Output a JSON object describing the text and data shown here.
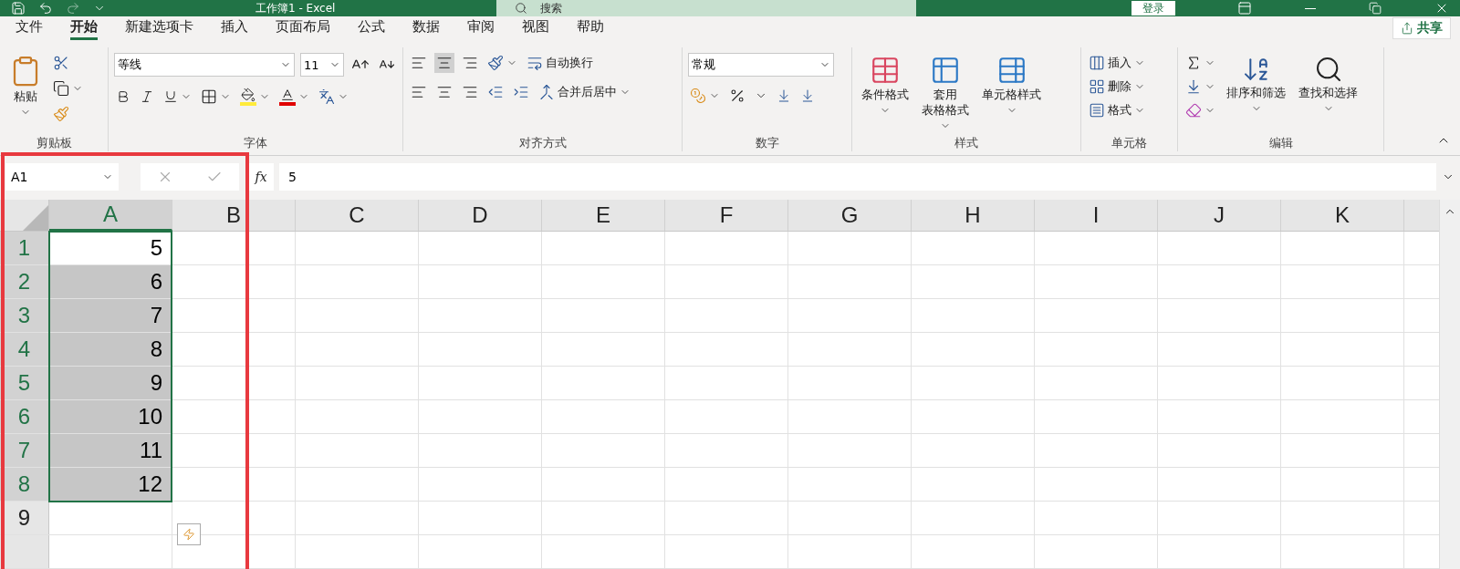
{
  "title_bar": {
    "title": "工作簿1 - Excel",
    "search_placeholder": "搜索",
    "login": "登录"
  },
  "tabs": [
    {
      "label": "文件",
      "selected": false
    },
    {
      "label": "开始",
      "selected": true
    },
    {
      "label": "新建选项卡",
      "selected": false
    },
    {
      "label": "插入",
      "selected": false
    },
    {
      "label": "页面布局",
      "selected": false
    },
    {
      "label": "公式",
      "selected": false
    },
    {
      "label": "数据",
      "selected": false
    },
    {
      "label": "审阅",
      "selected": false
    },
    {
      "label": "视图",
      "selected": false
    },
    {
      "label": "帮助",
      "selected": false
    }
  ],
  "share": "共享",
  "ribbon": {
    "clipboard": {
      "label": "剪贴板",
      "paste": "粘贴"
    },
    "font": {
      "label": "字体",
      "font_name": "等线",
      "font_size": "11"
    },
    "alignment": {
      "label": "对齐方式",
      "wrap": "自动换行",
      "merge": "合并后居中"
    },
    "number": {
      "label": "数字",
      "format": "常规"
    },
    "styles": {
      "label": "样式",
      "items": [
        "条件格式",
        "套用表格格式",
        "单元格样式"
      ]
    },
    "cells": {
      "label": "单元格",
      "items": [
        "插入",
        "删除",
        "格式"
      ]
    },
    "editing": {
      "label": "编辑",
      "items": [
        "排序和筛选",
        "查找和选择"
      ]
    }
  },
  "formula_bar": {
    "name_box": "A1",
    "fx": "fx",
    "value": "5"
  },
  "columns": [
    {
      "label": "A",
      "selected": true
    },
    {
      "label": "B",
      "selected": false
    },
    {
      "label": "C",
      "selected": false
    },
    {
      "label": "D",
      "selected": false
    },
    {
      "label": "E",
      "selected": false
    },
    {
      "label": "F",
      "selected": false
    },
    {
      "label": "G",
      "selected": false
    },
    {
      "label": "H",
      "selected": false
    },
    {
      "label": "I",
      "selected": false
    },
    {
      "label": "J",
      "selected": false
    },
    {
      "label": "K",
      "selected": false
    }
  ],
  "rows": [
    {
      "header": "1",
      "selected": true,
      "cells": [
        {
          "value": "5",
          "active": true
        }
      ]
    },
    {
      "header": "2",
      "selected": true,
      "cells": [
        {
          "value": "6",
          "active": false
        }
      ]
    },
    {
      "header": "3",
      "selected": true,
      "cells": [
        {
          "value": "7",
          "active": false
        }
      ]
    },
    {
      "header": "4",
      "selected": true,
      "cells": [
        {
          "value": "8",
          "active": false
        }
      ]
    },
    {
      "header": "5",
      "selected": true,
      "cells": [
        {
          "value": "9",
          "active": false
        }
      ]
    },
    {
      "header": "6",
      "selected": true,
      "cells": [
        {
          "value": "10",
          "active": false
        }
      ]
    },
    {
      "header": "7",
      "selected": true,
      "cells": [
        {
          "value": "11",
          "active": false
        }
      ]
    },
    {
      "header": "8",
      "selected": true,
      "cells": [
        {
          "value": "12",
          "active": false
        }
      ]
    },
    {
      "header": "9",
      "selected": false,
      "cells": []
    }
  ]
}
